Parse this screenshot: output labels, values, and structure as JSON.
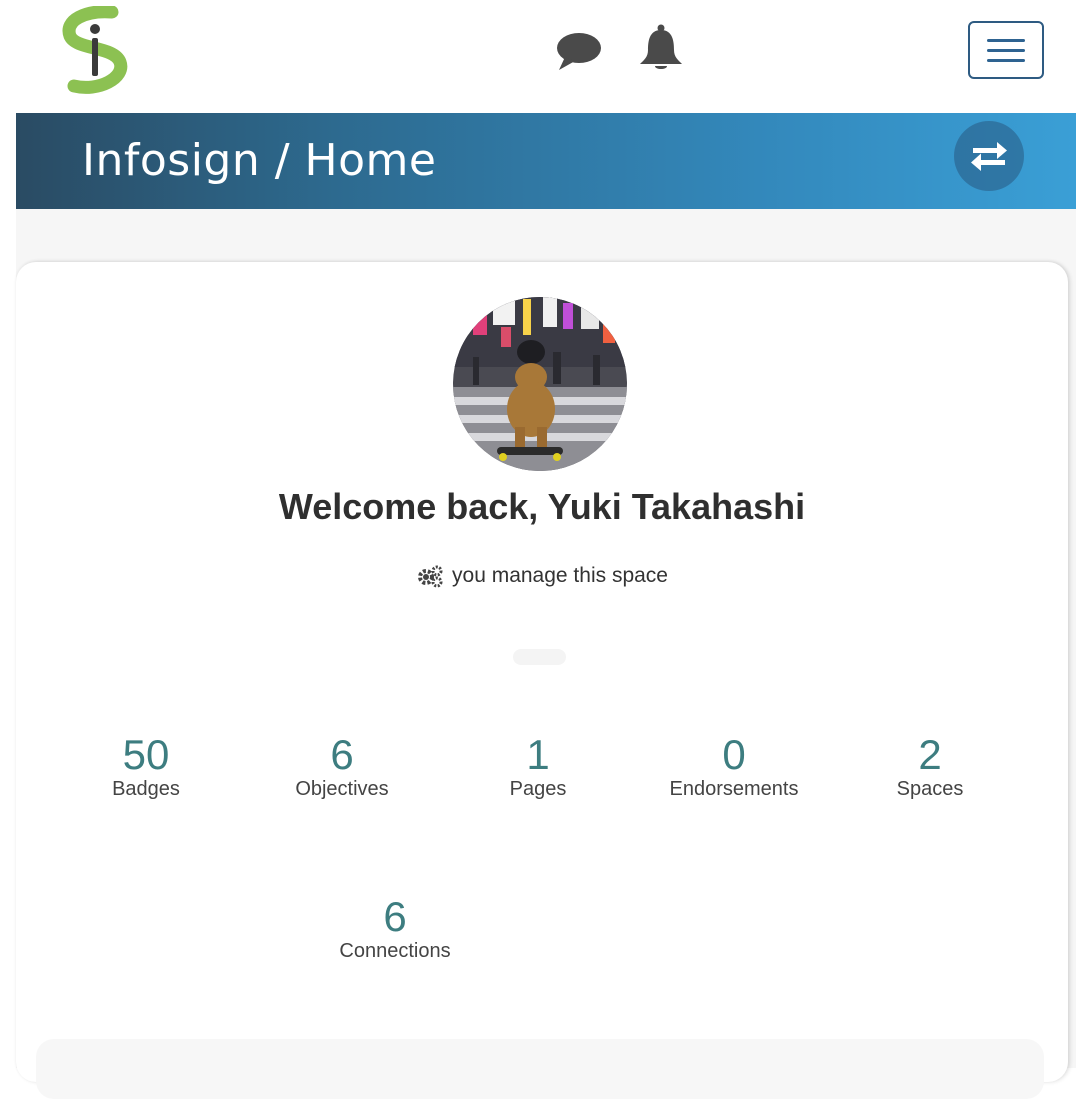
{
  "topnav": {
    "logo_name": "infosign-logo",
    "icons": [
      "chat-icon",
      "bell-icon",
      "menu-icon"
    ]
  },
  "banner": {
    "title": "Infosign / Home",
    "switch_icon": "swap-arrows-icon"
  },
  "profile": {
    "welcome": "Welcome back, Yuki Takahashi",
    "manage_text": "you manage this space",
    "manage_icon": "gears-icon"
  },
  "stats": [
    {
      "value": "50",
      "label": "Badges"
    },
    {
      "value": "6",
      "label": "Objectives"
    },
    {
      "value": "1",
      "label": "Pages"
    },
    {
      "value": "0",
      "label": "Endorsements"
    },
    {
      "value": "2",
      "label": "Spaces"
    },
    {
      "value": "6",
      "label": "Connections"
    }
  ],
  "colors": {
    "accent": "#3d7d80",
    "banner_start": "#2a4b63",
    "banner_end": "#3a9fd6",
    "logo_green": "#8cc152",
    "icon_dark": "#4a4a4a",
    "menu_blue": "#2e6391"
  }
}
